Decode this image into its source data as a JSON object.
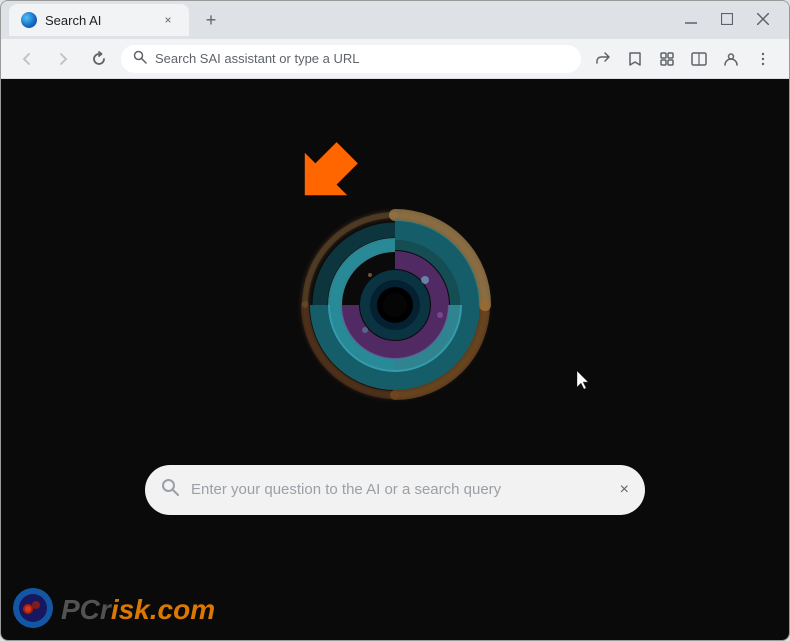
{
  "window": {
    "title": "Search AI"
  },
  "tab": {
    "label": "Search AI",
    "close_label": "×"
  },
  "new_tab_button": {
    "label": "+"
  },
  "window_controls": {
    "minimize": "—",
    "maximize": "□",
    "close": "✕"
  },
  "nav": {
    "back": "←",
    "forward": "→",
    "refresh": "↻"
  },
  "address_bar": {
    "placeholder": "Search SAI assistant or type a URL"
  },
  "address_icons": {
    "share": "⬆",
    "bookmark": "☆",
    "extensions": "🧩",
    "split": "⊞",
    "profile": "👤",
    "menu": "⋮"
  },
  "search_bar": {
    "placeholder": "Enter your question to the AI or a search query",
    "clear": "×"
  },
  "watermark": {
    "text_gray": "PC",
    "text_orange": "risk.com"
  },
  "colors": {
    "background": "#0a0a0a",
    "search_bg": "#f8f8f8",
    "accent_orange": "#ff8c00",
    "arrow_orange": "#ff6600"
  }
}
